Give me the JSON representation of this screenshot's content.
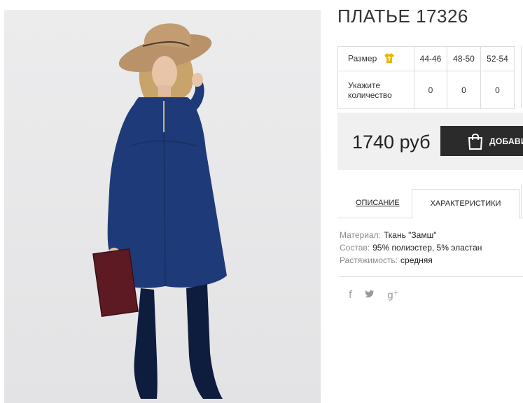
{
  "product": {
    "title": "ПЛАТЬЕ 17326",
    "image_alt": "Женщина в синем замшевом платье, шляпе и высоких сапогах"
  },
  "sizes": {
    "header_label": "Размер",
    "columns": [
      "44-46",
      "48-50",
      "52-54"
    ],
    "qty_label": "Укажите количество",
    "quantities": [
      "0",
      "0",
      "0"
    ]
  },
  "purchase": {
    "price": "1740 руб",
    "add_button_label": "ДОБАВИ"
  },
  "tabs": [
    {
      "label": "ОПИСАНИЕ",
      "active": false
    },
    {
      "label": "ХАРАКТЕРИСТИКИ",
      "active": true
    }
  ],
  "specs": [
    {
      "key": "Материал:",
      "value": "Ткань \"Замш\""
    },
    {
      "key": "Состав:",
      "value": "95% полиэстер, 5% эластан"
    },
    {
      "key": "Растяжимость:",
      "value": "средняя"
    }
  ],
  "social": [
    "facebook-icon",
    "twitter-icon",
    "google-plus-icon"
  ],
  "colors": {
    "dress": "#1e3a78",
    "button": "#2b2b2b",
    "price_bg": "#f0f0f0",
    "size_icon": "#f0b400"
  }
}
